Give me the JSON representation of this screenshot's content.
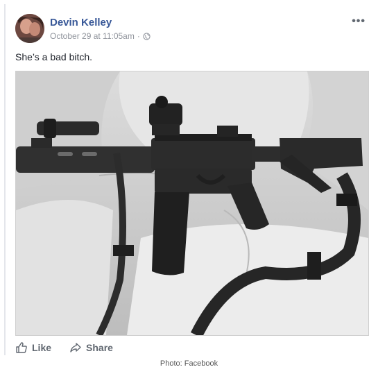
{
  "post": {
    "author": "Devin Kelley",
    "timestamp": "October 29 at 11:05am",
    "separator": "·",
    "privacy_icon": "globe-icon",
    "more_label": "•••",
    "text": "She’s a bad bitch."
  },
  "actions": {
    "like_label": "Like",
    "share_label": "Share"
  },
  "caption": "Photo: Facebook"
}
